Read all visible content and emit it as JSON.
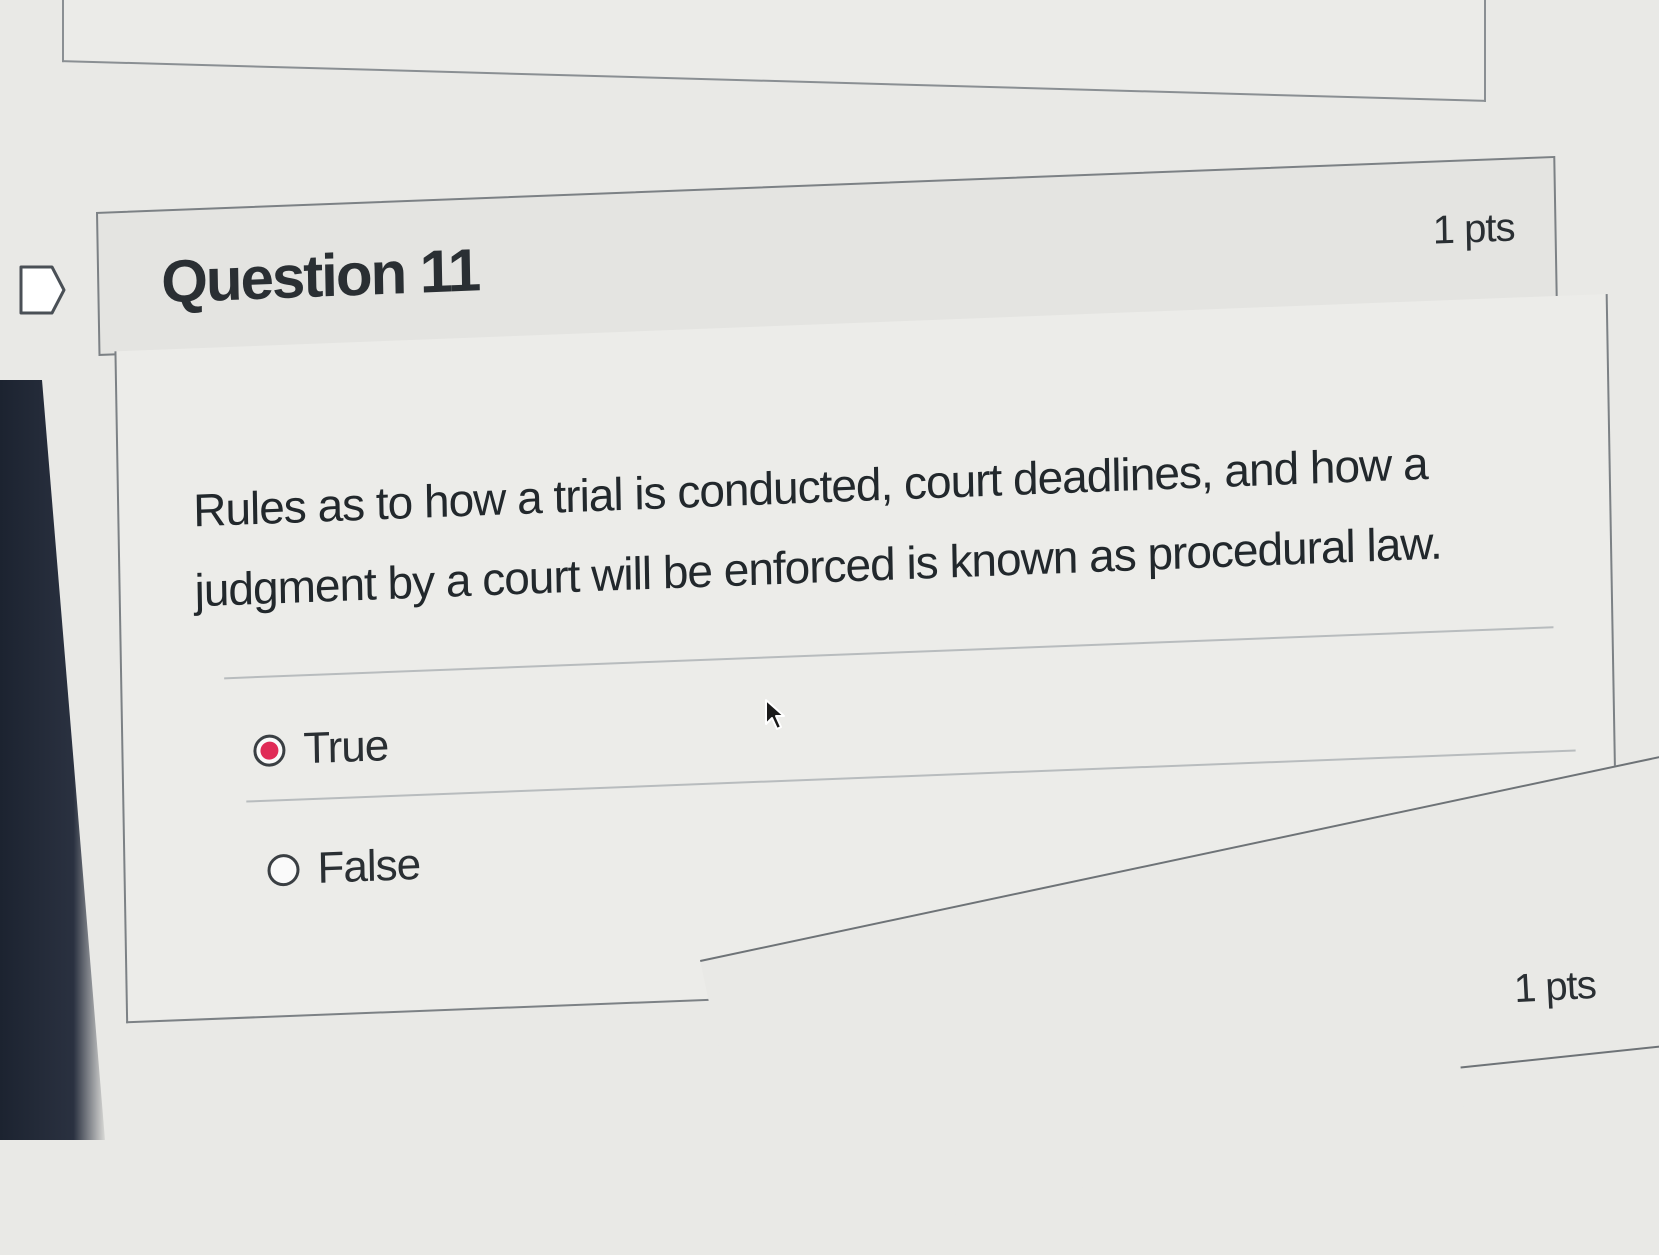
{
  "question": {
    "title": "Question 11",
    "points": "1 pts",
    "text": "Rules as to how a trial is conducted, court deadlines, and how a judgment by a court will be enforced is known as procedural law.",
    "answers": [
      {
        "label": "True",
        "selected": true
      },
      {
        "label": "False",
        "selected": false
      }
    ]
  },
  "next_question": {
    "points": "1 pts"
  },
  "colors": {
    "radio_selected": "#e02b57",
    "border": "#7c8185",
    "header_bg": "#e4e4e1"
  },
  "icons": {
    "flag": "flag-question-icon",
    "cursor": "mouse-pointer-icon"
  }
}
